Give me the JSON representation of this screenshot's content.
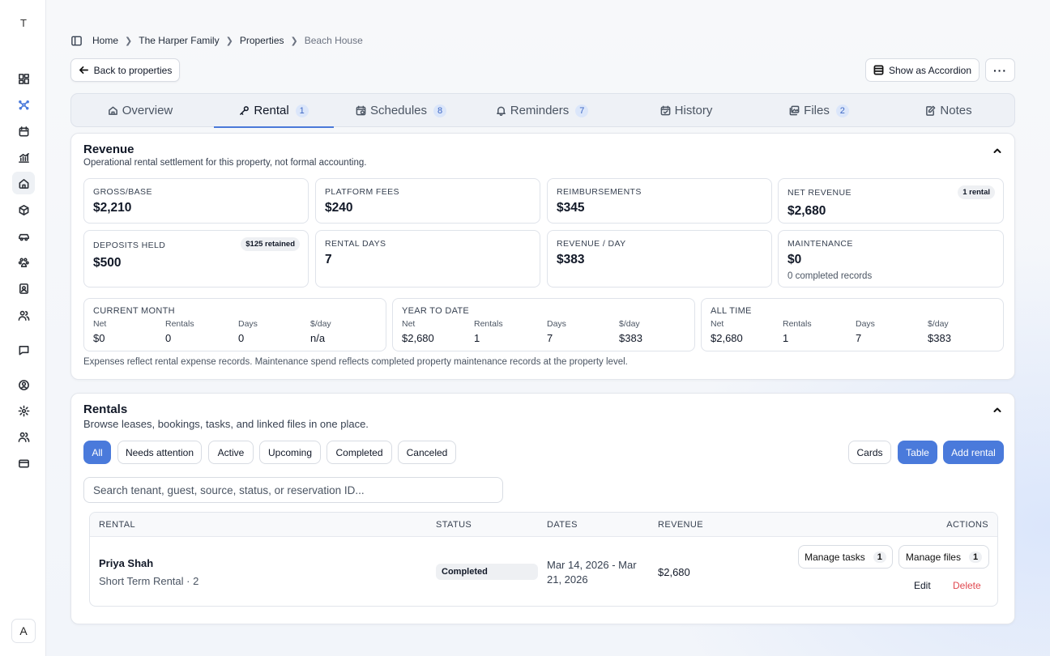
{
  "sidebar": {
    "workspace_initial": "T",
    "user_initial": "A",
    "icons": [
      "dashboard-icon",
      "sparkle-icon",
      "calendar-icon",
      "chart-icon",
      "home-icon",
      "box-icon",
      "car-icon",
      "pets-icon",
      "contact-card-icon",
      "people-icon",
      "message-icon",
      "user-circle-icon",
      "settings-icon",
      "users-icon",
      "credit-card-icon"
    ]
  },
  "breadcrumb": {
    "items": [
      "Home",
      "The Harper Family",
      "Properties"
    ],
    "current": "Beach House"
  },
  "toolbar": {
    "back_label": "Back to properties",
    "accordion_label": "Show as Accordion",
    "more_label": "···"
  },
  "tabs": [
    {
      "label": "Overview",
      "badge": ""
    },
    {
      "label": "Rental",
      "badge": "1"
    },
    {
      "label": "Schedules",
      "badge": "8"
    },
    {
      "label": "Reminders",
      "badge": "7"
    },
    {
      "label": "History",
      "badge": ""
    },
    {
      "label": "Files",
      "badge": "2"
    },
    {
      "label": "Notes",
      "badge": ""
    }
  ],
  "revenue": {
    "title": "Revenue",
    "subtitle": "Operational rental settlement for this property, not formal accounting.",
    "stats": [
      {
        "label": "Gross/Base",
        "value": "$2,210"
      },
      {
        "label": "Platform fees",
        "value": "$240"
      },
      {
        "label": "Reimbursements",
        "value": "$345"
      },
      {
        "label": "Net revenue",
        "value": "$2,680",
        "pill": "1 rental"
      },
      {
        "label": "Deposits held",
        "value": "$500",
        "pill": "$125 retained"
      },
      {
        "label": "Rental days",
        "value": "7"
      },
      {
        "label": "Revenue / day",
        "value": "$383"
      },
      {
        "label": "Maintenance",
        "value": "$0",
        "note": "0 completed records"
      }
    ],
    "periods": [
      {
        "label": "Current month",
        "cols": [
          {
            "k": "Net",
            "v": "$0"
          },
          {
            "k": "Rentals",
            "v": "0"
          },
          {
            "k": "Days",
            "v": "0"
          },
          {
            "k": "$/day",
            "v": "n/a"
          }
        ]
      },
      {
        "label": "Year to date",
        "cols": [
          {
            "k": "Net",
            "v": "$2,680"
          },
          {
            "k": "Rentals",
            "v": "1"
          },
          {
            "k": "Days",
            "v": "7"
          },
          {
            "k": "$/day",
            "v": "$383"
          }
        ]
      },
      {
        "label": "All time",
        "cols": [
          {
            "k": "Net",
            "v": "$2,680"
          },
          {
            "k": "Rentals",
            "v": "1"
          },
          {
            "k": "Days",
            "v": "7"
          },
          {
            "k": "$/day",
            "v": "$383"
          }
        ]
      }
    ],
    "footnote": "Expenses reflect rental expense records. Maintenance spend reflects completed property maintenance records at the property level."
  },
  "rentals": {
    "title": "Rentals",
    "subtitle": "Browse leases, bookings, tasks, and linked files in one place.",
    "filters": [
      "All",
      "Needs attention",
      "Active",
      "Upcoming",
      "Completed",
      "Canceled"
    ],
    "view_cards": "Cards",
    "view_table": "Table",
    "add_label": "Add rental",
    "search_placeholder": "Search tenant, guest, source, status, or reservation ID...",
    "columns": [
      "Rental",
      "Status",
      "Dates",
      "Revenue",
      "Actions"
    ],
    "rows": [
      {
        "name": "Priya Shah",
        "detail": "Short Term Rental · 2",
        "status": "Completed",
        "dates_line1": "Mar 14, 2026 - Mar",
        "dates_line2": "21, 2026",
        "revenue": "$2,680",
        "tasks_label": "Manage tasks",
        "tasks_count": "1",
        "files_label": "Manage files",
        "files_count": "1",
        "edit_label": "Edit",
        "delete_label": "Delete"
      }
    ]
  },
  "colors": {
    "accent": "#4a7adb",
    "danger": "#e0484f",
    "badge_bg": "#dbe6fa"
  }
}
